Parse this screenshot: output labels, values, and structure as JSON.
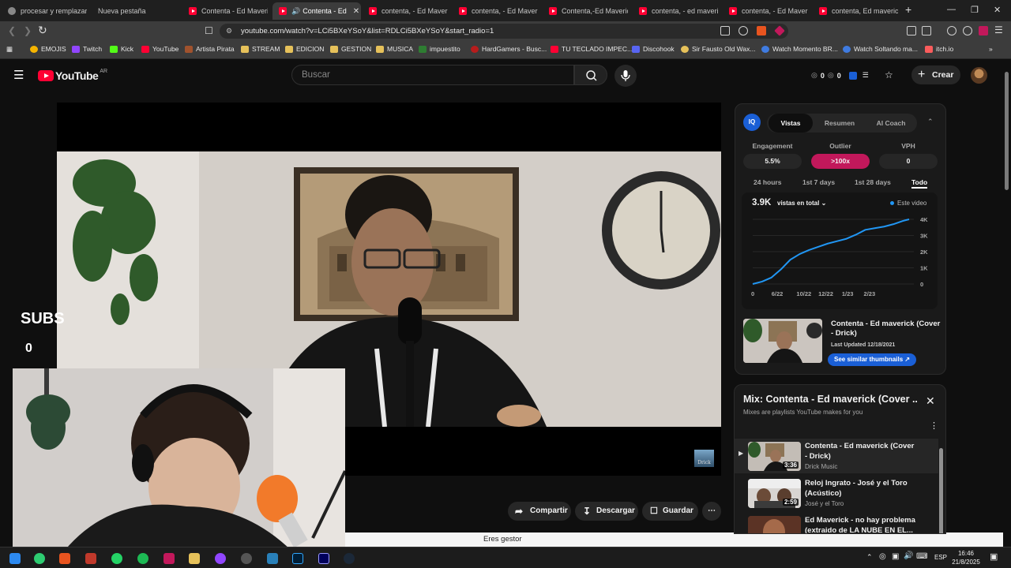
{
  "browser": {
    "tabs": [
      {
        "label": "procesar y remplazar s",
        "icon": "google-icon"
      },
      {
        "label": "Nueva pestaña",
        "icon": "none"
      },
      {
        "label": "Contenta - Ed Maverick",
        "icon": "youtube-icon"
      },
      {
        "label": "Contenta - Ed",
        "icon": "youtube-icon",
        "active": true
      },
      {
        "label": "contenta, - Ed Maverick",
        "icon": "youtube-icon"
      },
      {
        "label": "contenta, - Ed Maverick",
        "icon": "youtube-icon"
      },
      {
        "label": "Contenta,-Ed Maverick",
        "icon": "youtube-icon"
      },
      {
        "label": "contenta, - ed maverick",
        "icon": "youtube-icon"
      },
      {
        "label": "contenta, - Ed Maverick",
        "icon": "youtube-icon"
      },
      {
        "label": "contenta, Ed maverick",
        "icon": "youtube-icon"
      }
    ],
    "new_tab": "+",
    "url": "youtube.com/watch?v=LCi5BXeYSoY&list=RDLCi5BXeYSoY&start_radio=1",
    "bookmarks": [
      "EMOJIS",
      "Twitch",
      "Kick",
      "YouTube",
      "Artista Pirata",
      "STREAM",
      "EDICION",
      "GESTION",
      "MUSICA",
      "impuestito",
      "HardGamers - Busc...",
      "TU TECLADO IMPEC...",
      "Discohook",
      "Sir Fausto Old Wax...",
      "Watch Momento BR...",
      "Watch Soltando ma...",
      "itch.io"
    ]
  },
  "youtube": {
    "logo_text": "YouTube",
    "region": "AR",
    "search_placeholder": "Buscar",
    "counters": [
      "0",
      "0"
    ],
    "create_label": "Crear"
  },
  "overlay": {
    "subs_label": "SUBS",
    "subs_value": "0",
    "watermark": "Drick"
  },
  "actions": {
    "share": "Compartir",
    "download": "Descargar",
    "save": "Guardar"
  },
  "notice": "Eres gestor",
  "iq_panel": {
    "badge": "IQ",
    "tabs": [
      "Vistas",
      "Resumen",
      "AI Coach"
    ],
    "active_tab": "Vistas",
    "metrics": [
      {
        "label": "Engagement",
        "value": "5.5%"
      },
      {
        "label": "Outlier",
        "value": ">100x"
      },
      {
        "label": "VPH",
        "value": "0"
      }
    ],
    "periods": [
      "24 hours",
      "1st 7 days",
      "1st 28 days",
      "Todo"
    ],
    "active_period": "Todo",
    "total_views": "3.9K",
    "views_dropdown": "vistas en total",
    "legend": "Este video",
    "video_title": "Contenta - Ed maverick (Cover - Drick)",
    "last_updated": "Last Updated 12/18/2021",
    "similar_button": "See similar thumbnails",
    "accent": "#2196f3",
    "outlier_color": "#c2185b"
  },
  "chart_data": {
    "type": "line",
    "x_labels": [
      "0",
      "6/22",
      "10/22",
      "12/22",
      "1/23",
      "2/23"
    ],
    "y_ticks": [
      "0",
      "1K",
      "2K",
      "3K",
      "4K"
    ],
    "ylim": [
      0,
      4000
    ],
    "series": [
      {
        "name": "Este video",
        "x": [
          0,
          0.06,
          0.12,
          0.18,
          0.24,
          0.3,
          0.36,
          0.42,
          0.48,
          0.54,
          0.6,
          0.66,
          0.72,
          0.78,
          0.84,
          0.9,
          0.96,
          1.0
        ],
        "y": [
          0,
          150,
          400,
          900,
          1500,
          1850,
          2100,
          2300,
          2500,
          2650,
          2800,
          3050,
          3350,
          3450,
          3550,
          3700,
          3900,
          4000
        ]
      }
    ]
  },
  "mix": {
    "title": "Mix: Contenta - Ed maverick (Cover ...",
    "subtitle": "Mixes are playlists YouTube makes for you",
    "items": [
      {
        "title": "Contenta - Ed maverick (Cover - Drick)",
        "channel": "Drick Music",
        "duration": "3:36",
        "playing": true
      },
      {
        "title": "Reloj Ingrato - José y el Toro (Acústico)",
        "channel": "José y el Toro",
        "duration": "2:59"
      },
      {
        "title": "Ed Maverick - no hay problema (extraido de LA NUBE EN EL...",
        "channel": "",
        "duration": ""
      }
    ]
  },
  "taskbar": {
    "lang": "ESP",
    "time": "16:46",
    "date": "21/8/2025"
  }
}
